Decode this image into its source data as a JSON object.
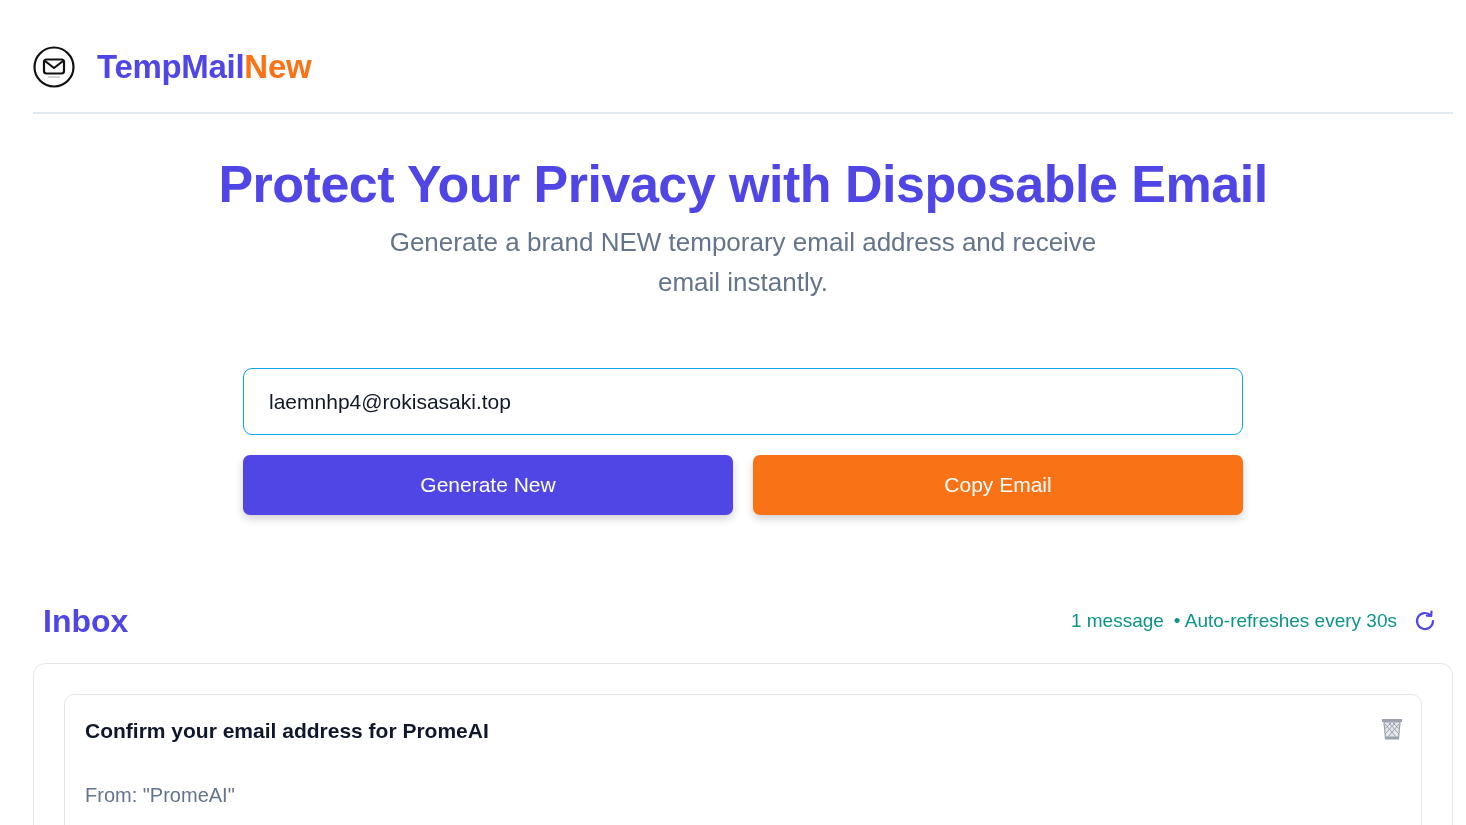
{
  "header": {
    "brand": {
      "primary": "TempMail",
      "accent": "New"
    }
  },
  "hero": {
    "title": "Protect Your Privacy with Disposable Email",
    "subtitle": "Generate a brand NEW temporary email address and receive email instantly."
  },
  "email_field": {
    "value": "laemnhp4@rokisasaki.top"
  },
  "buttons": [
    {
      "label": "Generate New",
      "kind": "primary"
    },
    {
      "label": "Copy Email",
      "kind": "accent"
    }
  ],
  "inbox": {
    "title": "Inbox",
    "count": "1 message",
    "refresh_note": "• Auto-refreshes every 30s",
    "messages": [
      {
        "subject": "Confirm your email address for PromeAI",
        "from": "From: \"PromeAI\""
      }
    ]
  }
}
